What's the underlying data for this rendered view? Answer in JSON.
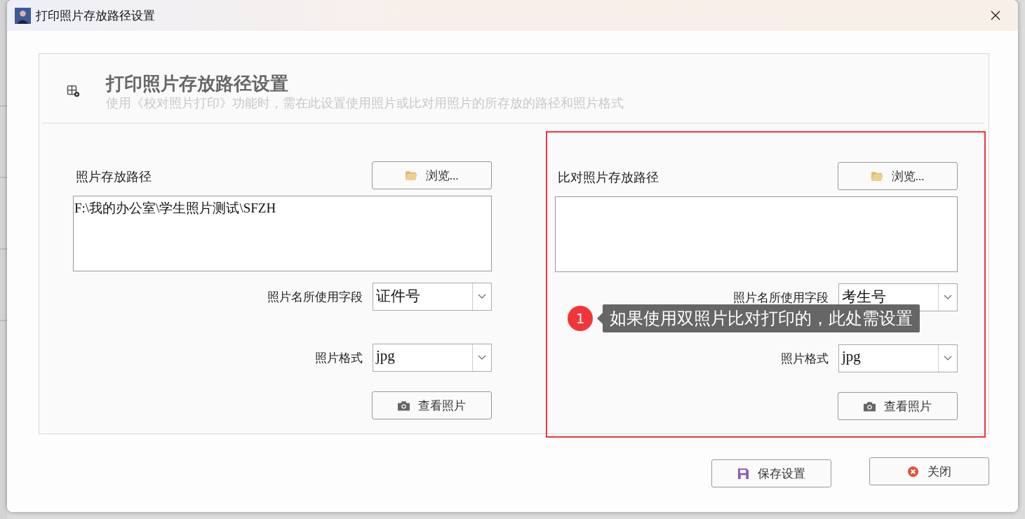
{
  "window": {
    "title": "打印照片存放路径设置"
  },
  "header": {
    "title": "打印照片存放路径设置",
    "subtitle": "使用《校对照片打印》功能时，需在此设置使用照片或比对用照片的所存放的路径和照片格式"
  },
  "sections": [
    {
      "path_label": "照片存放路径",
      "browse_button": "浏览...",
      "path": "F:\\我的办公室\\学生照片测试\\SFZH",
      "name_field_label": "照片名所使用字段",
      "name_field": "证件号",
      "format_label": "照片格式",
      "format": "jpg",
      "view_button": "查看照片",
      "highlighted": false
    },
    {
      "path_label": "比对照片存放路径",
      "browse_button": "浏览...",
      "name_field_label": "照片名所使用字段",
      "name_field": "考生号",
      "format_label": "照片格式",
      "format": "jpg",
      "view_button": "查看照片",
      "highlighted": true
    }
  ],
  "annotation": {
    "number": "1",
    "text": "如果使用双照片比对打印的，此处需设置"
  },
  "buttons": [
    {
      "kind": "save",
      "label": "保存设置"
    },
    {
      "kind": "close",
      "label": "关闭"
    }
  ]
}
